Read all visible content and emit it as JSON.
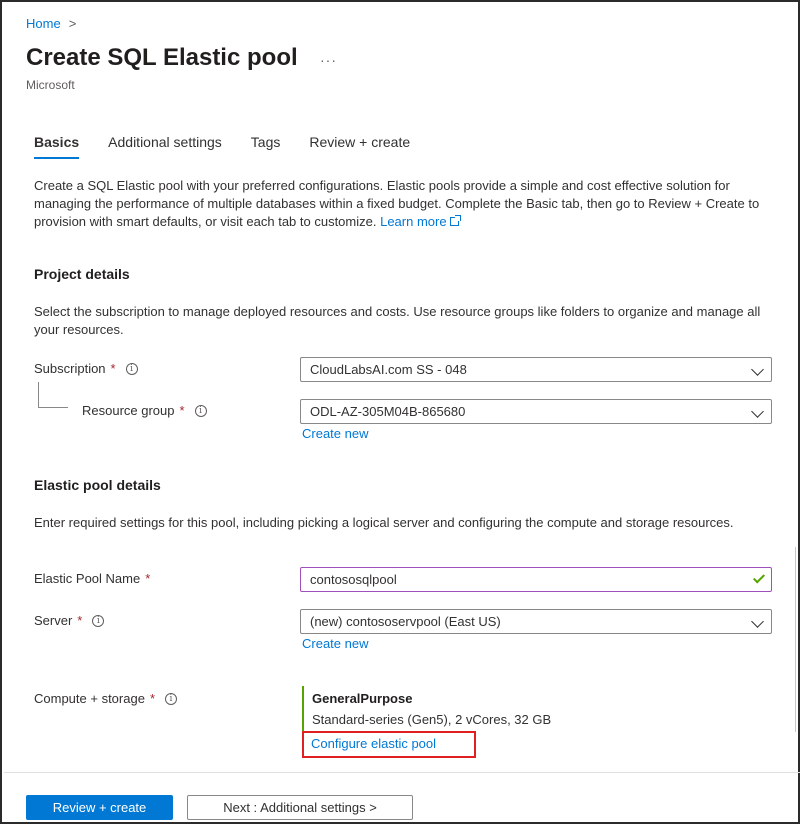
{
  "breadcrumb": {
    "home": "Home",
    "separator": ">"
  },
  "header": {
    "title": "Create SQL Elastic pool",
    "more": "···",
    "publisher": "Microsoft"
  },
  "tabs": [
    {
      "label": "Basics",
      "active": true
    },
    {
      "label": "Additional settings",
      "active": false
    },
    {
      "label": "Tags",
      "active": false
    },
    {
      "label": "Review + create",
      "active": false
    }
  ],
  "intro": {
    "text": "Create a SQL Elastic pool with your preferred configurations. Elastic pools provide a simple and cost effective solution for managing the performance of multiple databases within a fixed budget. Complete the Basic tab, then go to Review + Create to provision with smart defaults, or visit each tab to customize. ",
    "learn_more": "Learn more"
  },
  "project": {
    "title": "Project details",
    "desc": "Select the subscription to manage deployed resources and costs. Use resource groups like folders to organize and manage all your resources.",
    "subscription_label": "Subscription",
    "subscription_value": "CloudLabsAI.com SS - 048",
    "resource_group_label": "Resource group",
    "resource_group_value": "ODL-AZ-305M04B-865680",
    "create_new": "Create new"
  },
  "pool": {
    "title": "Elastic pool details",
    "desc": "Enter required settings for this pool, including picking a logical server and configuring the compute and storage resources.",
    "name_label": "Elastic Pool Name",
    "name_value": "contososqlpool",
    "server_label": "Server",
    "server_value": "(new) contososervpool (East US)",
    "create_new": "Create new",
    "compute_label": "Compute + storage",
    "compute_tier": "GeneralPurpose",
    "compute_detail": "Standard-series (Gen5), 2 vCores, 32 GB",
    "configure_link": "Configure elastic pool"
  },
  "required_mark": "*",
  "info_glyph": "i",
  "footer": {
    "review_button": "Review + create",
    "next_button": "Next : Additional settings >"
  },
  "colors": {
    "accent": "#0078d4",
    "required": "#a4262c",
    "valid": "#57a300",
    "highlight": "#e02020"
  }
}
